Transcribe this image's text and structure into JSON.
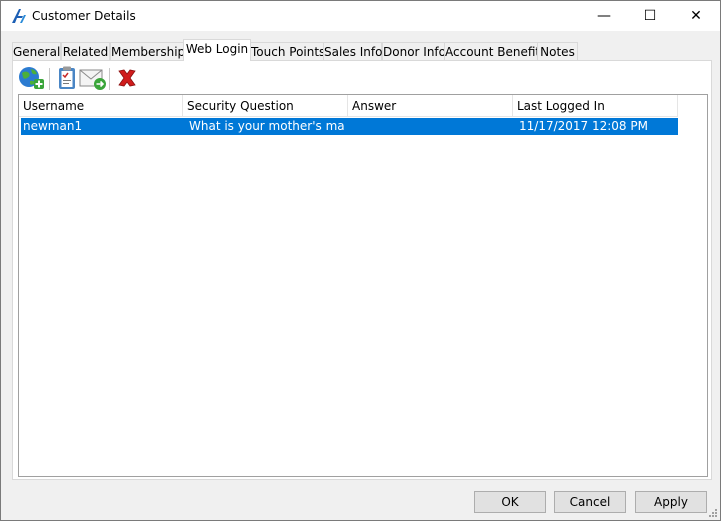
{
  "window": {
    "title": "Customer Details",
    "minimize_glyph": "—",
    "maximize_glyph": "☐",
    "close_glyph": "✕"
  },
  "tabs": [
    {
      "label": "General",
      "active": false
    },
    {
      "label": "Related",
      "active": false
    },
    {
      "label": "Memberships",
      "active": false
    },
    {
      "label": "Web Login",
      "active": true
    },
    {
      "label": "Touch Points",
      "active": false
    },
    {
      "label": "Sales Info",
      "active": false
    },
    {
      "label": "Donor Info",
      "active": false
    },
    {
      "label": "Account Benefits",
      "active": false
    },
    {
      "label": "Notes",
      "active": false
    }
  ],
  "toolbar": {
    "icons": [
      "add-web-login-icon",
      "clipboard-icon",
      "email-icon",
      "delete-icon"
    ]
  },
  "grid": {
    "columns": [
      "Username",
      "Security Question",
      "Answer",
      "Last Logged In"
    ],
    "rows": [
      {
        "username": "newman1",
        "security_question": "What is your mother's maiden ...",
        "answer": "",
        "last_logged_in": "11/17/2017 12:08 PM",
        "selected": true
      }
    ]
  },
  "buttons": {
    "ok": "OK",
    "cancel": "Cancel",
    "apply": "Apply"
  },
  "colors": {
    "selection": "#0078d7",
    "window_bg": "#f0f0f0"
  }
}
